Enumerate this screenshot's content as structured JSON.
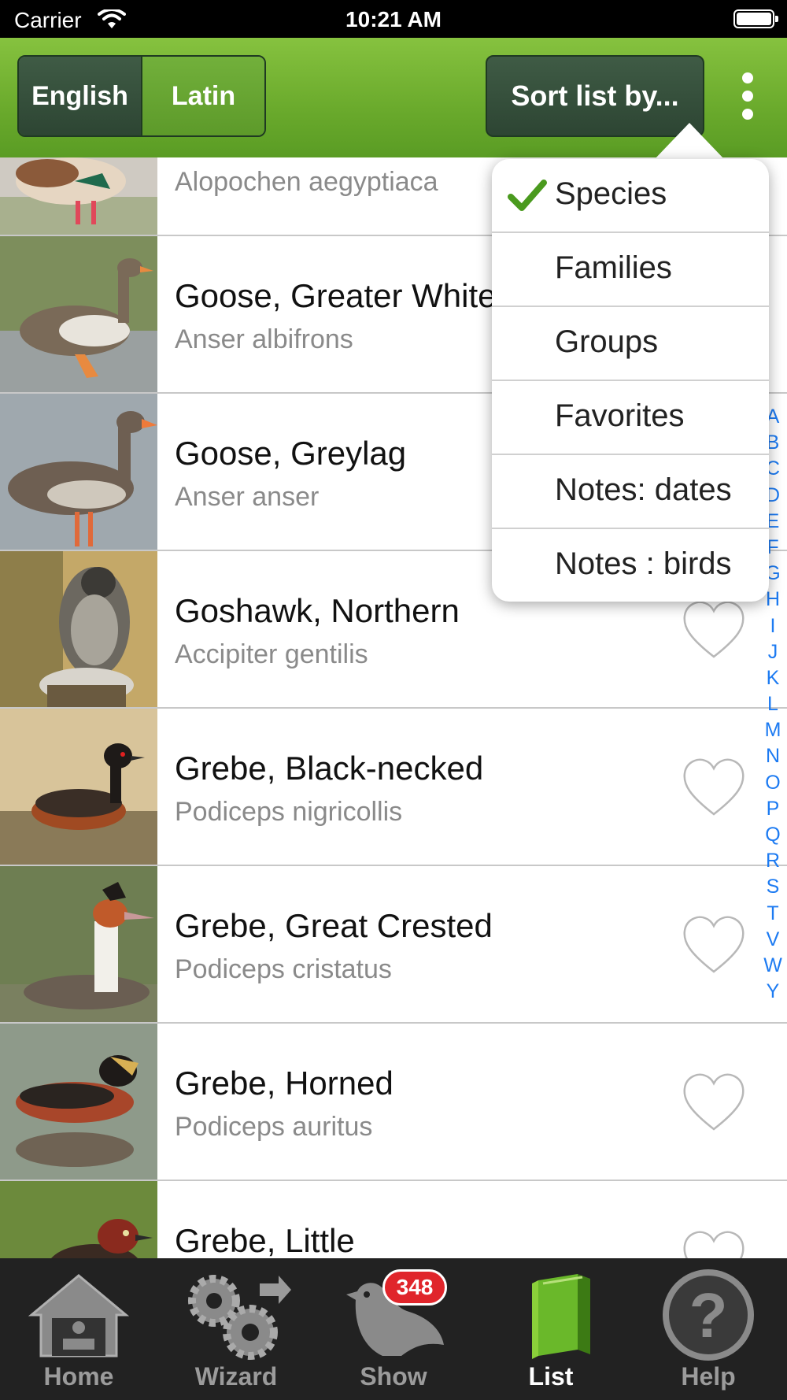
{
  "status_bar": {
    "carrier": "Carrier",
    "time": "10:21 AM"
  },
  "header": {
    "language_toggle": {
      "english_label": "English",
      "latin_label": "Latin",
      "selected": "Latin"
    },
    "sort_button_label": "Sort list by...",
    "more_icon": "vertical-ellipsis-icon"
  },
  "sort_menu": {
    "items": [
      {
        "label": "Species",
        "checked": true
      },
      {
        "label": "Families",
        "checked": false
      },
      {
        "label": "Groups",
        "checked": false
      },
      {
        "label": "Favorites",
        "checked": false
      },
      {
        "label": "Notes: dates",
        "checked": false
      },
      {
        "label": "Notes : birds",
        "checked": false
      }
    ]
  },
  "birds": [
    {
      "name": "",
      "latin": "Alopochen aegyptiaca"
    },
    {
      "name": "Goose, Greater White-fronted",
      "latin": "Anser albifrons"
    },
    {
      "name": "Goose, Greylag",
      "latin": "Anser anser"
    },
    {
      "name": "Goshawk, Northern",
      "latin": "Accipiter gentilis"
    },
    {
      "name": "Grebe, Black-necked",
      "latin": "Podiceps nigricollis"
    },
    {
      "name": "Grebe, Great Crested",
      "latin": "Podiceps cristatus"
    },
    {
      "name": "Grebe, Horned",
      "latin": "Podiceps auritus"
    },
    {
      "name": "Grebe, Little",
      "latin": ""
    }
  ],
  "alphabet_index": [
    "A",
    "B",
    "C",
    "D",
    "E",
    "F",
    "G",
    "H",
    "I",
    "J",
    "K",
    "L",
    "M",
    "N",
    "O",
    "P",
    "Q",
    "R",
    "S",
    "T",
    "V",
    "W",
    "Y"
  ],
  "tab_bar": {
    "tabs": [
      {
        "label": "Home",
        "icon": "house-icon"
      },
      {
        "label": "Wizard",
        "icon": "gears-icon"
      },
      {
        "label": "Show",
        "icon": "bird-icon"
      },
      {
        "label": "List",
        "icon": "book-icon"
      },
      {
        "label": "Help",
        "icon": "question-icon"
      }
    ],
    "active": "List",
    "show_badge": "348"
  },
  "colors": {
    "header_green": "#6aaa2c",
    "dark_button": "#2d4533",
    "check_green": "#4a9a1e",
    "index_blue": "#1d7bf2",
    "badge_red": "#e0252b"
  }
}
